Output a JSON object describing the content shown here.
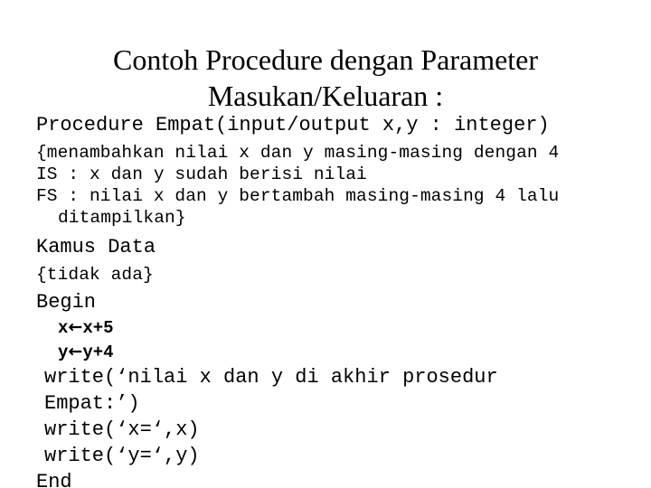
{
  "slide": {
    "title": "Contoh Procedure dengan Parameter Masukan/Keluaran :",
    "background_color": "#ffffff",
    "text_color": "#000000"
  },
  "code": {
    "signature": "Procedure Empat(input/output x,y : integer)",
    "comment_1": "{menambahkan nilai x dan y masing-masing dengan 4",
    "comment_is": "IS : x dan y sudah berisi nilai",
    "comment_fs": "FS : nilai x dan y bertambah masing-masing 4 lalu",
    "comment_fs_cont": "ditampilkan}",
    "kamus_header": "Kamus Data",
    "kamus_body": "{tidak ada}",
    "begin": "Begin",
    "assign_x_var": "x",
    "assign_x_arrow": "←",
    "assign_x_expr": "x+5",
    "assign_y_var": "y",
    "assign_y_arrow": "←",
    "assign_y_expr": "y+4",
    "write_1": "write(‘nilai x dan y di akhir prosedur",
    "write_1_cont": "Empat:’)",
    "write_2": "write(‘x=‘,x)",
    "write_3": "write(‘y=‘,y)",
    "end": "End"
  }
}
